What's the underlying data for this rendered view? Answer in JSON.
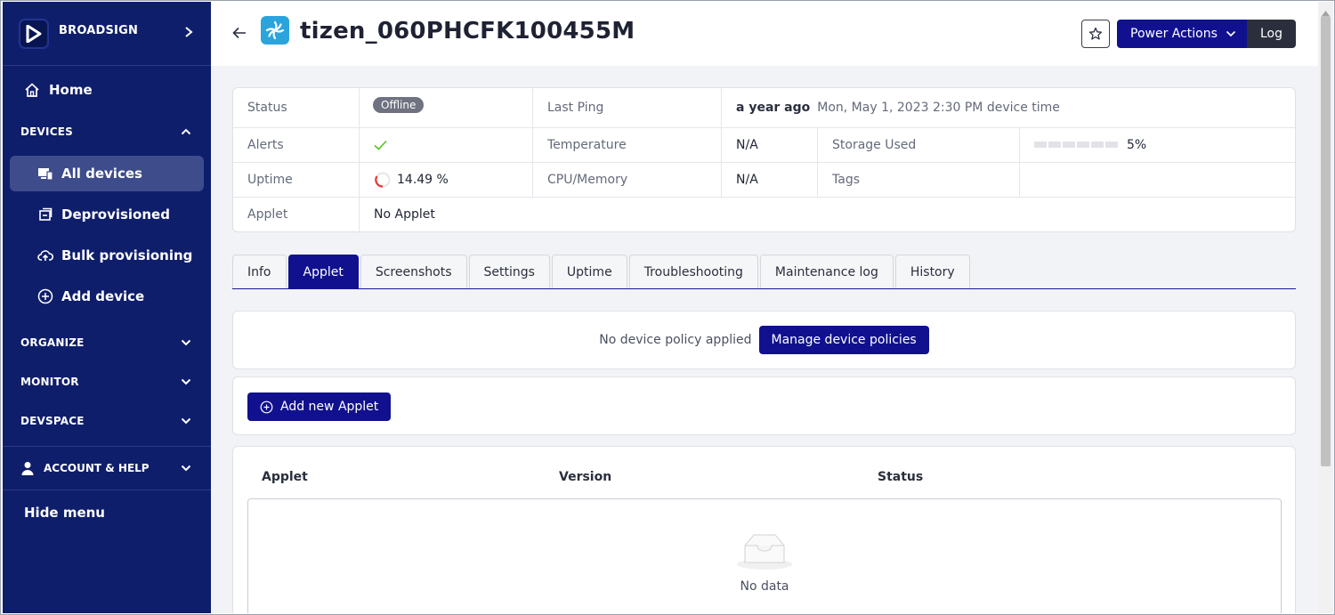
{
  "sidebar": {
    "brand": "BROADSIGN",
    "home": "Home",
    "devices_section": "DEVICES",
    "devices_items": [
      {
        "label": "All devices",
        "icon": "devices-icon"
      },
      {
        "label": "Deprovisioned",
        "icon": "deprovisioned-icon"
      },
      {
        "label": "Bulk provisioning",
        "icon": "cloud-upload-icon"
      },
      {
        "label": "Add device",
        "icon": "add-circle-icon"
      }
    ],
    "organize": "ORGANIZE",
    "monitor": "MONITOR",
    "devspace": "DEVSPACE",
    "account": "ACCOUNT & HELP",
    "hide_menu": "Hide menu"
  },
  "header": {
    "title": "tizen_060PHCFK100455M",
    "power_actions": "Power Actions",
    "log": "Log"
  },
  "info": {
    "status_label": "Status",
    "status_value": "Offline",
    "last_ping_label": "Last Ping",
    "last_ping_ago": "a year ago",
    "last_ping_time": "Mon, May 1, 2023 2:30 PM device time",
    "alerts_label": "Alerts",
    "temperature_label": "Temperature",
    "temperature_value": "N/A",
    "storage_label": "Storage Used",
    "storage_value": "5%",
    "uptime_label": "Uptime",
    "uptime_value": "14.49 %",
    "cpu_label": "CPU/Memory",
    "cpu_value": "N/A",
    "tags_label": "Tags",
    "applet_label": "Applet",
    "applet_value": "No Applet"
  },
  "tabs": [
    "Info",
    "Applet",
    "Screenshots",
    "Settings",
    "Uptime",
    "Troubleshooting",
    "Maintenance log",
    "History"
  ],
  "active_tab": "Applet",
  "policy": {
    "text": "No device policy applied",
    "button": "Manage device policies"
  },
  "applet_section": {
    "add_button": "Add new Applet",
    "columns": [
      "Applet",
      "Version",
      "Status"
    ],
    "empty_text": "No data"
  },
  "colors": {
    "sidebar_bg": "#0f1e6b",
    "primary": "#11118f",
    "check_green": "#52c41a",
    "device_icon_bg": "#2ba3dd"
  }
}
